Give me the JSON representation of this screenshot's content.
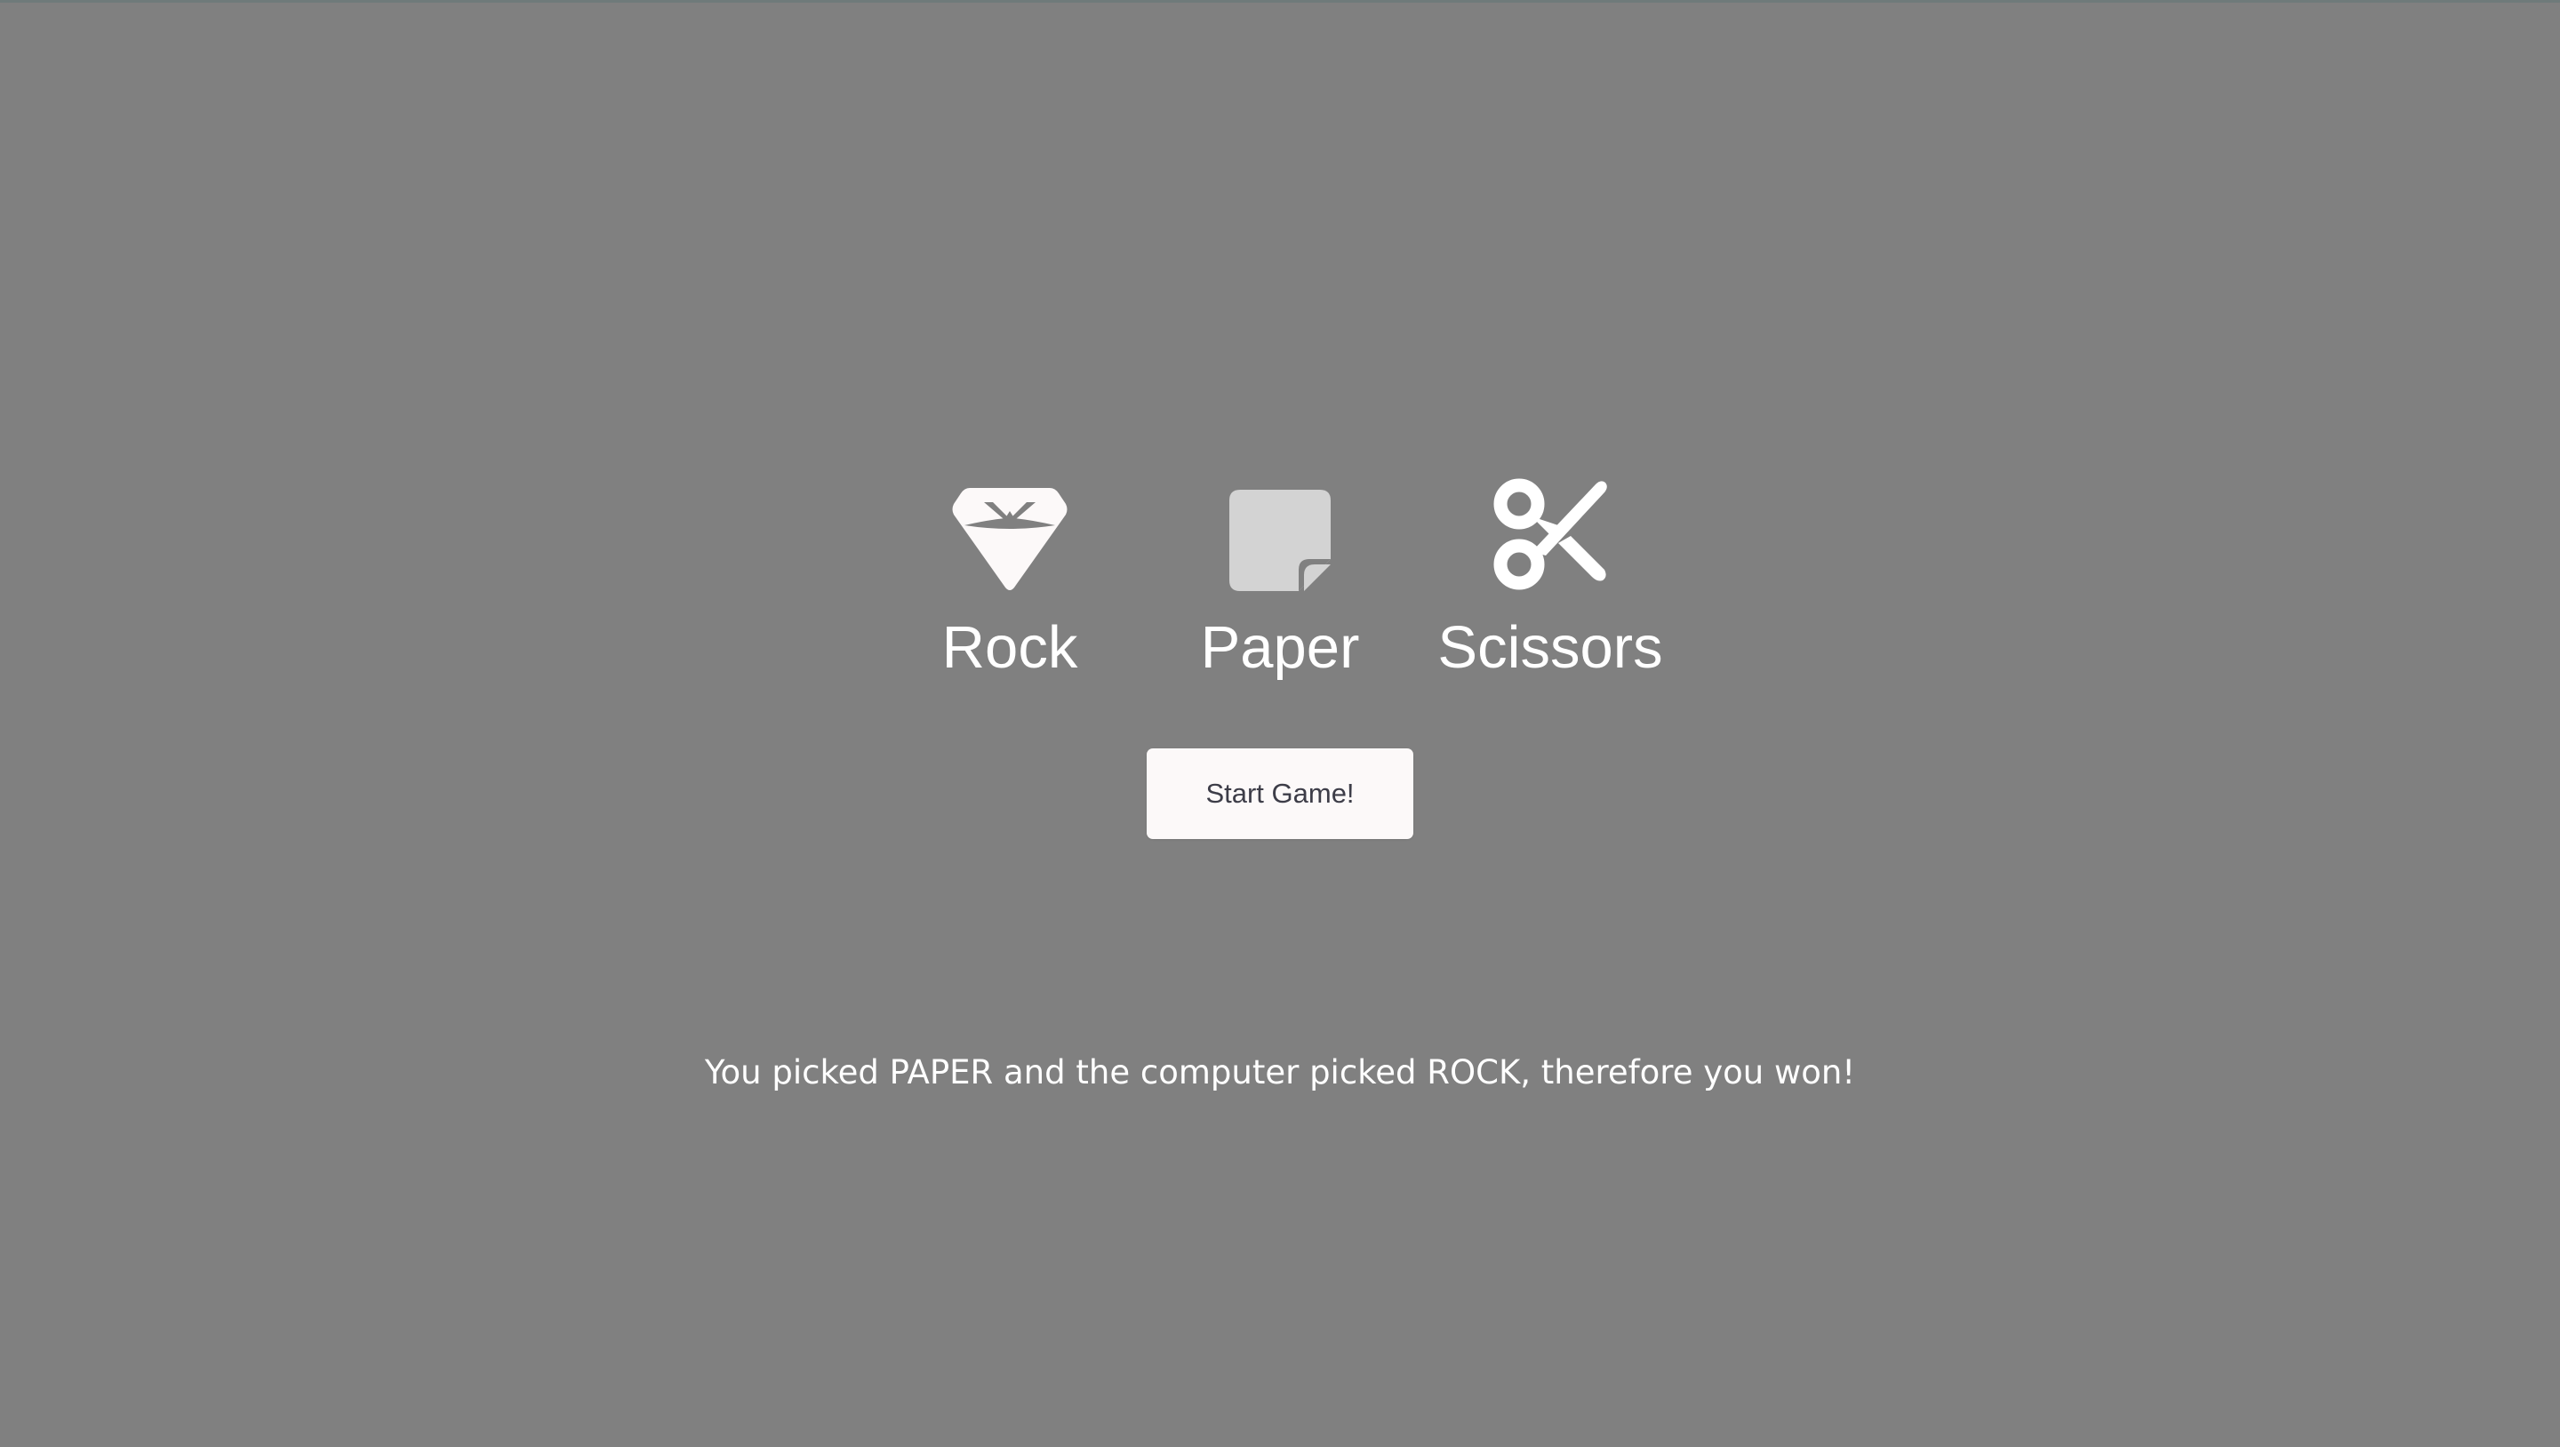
{
  "background_color": "#808080",
  "choices": [
    {
      "id": "rock",
      "label": "Rock",
      "icon": "gem-icon"
    },
    {
      "id": "paper",
      "label": "Paper",
      "icon": "sticky-note-icon"
    },
    {
      "id": "scissors",
      "label": "Scissors",
      "icon": "scissors-icon"
    }
  ],
  "start_button": {
    "label": "Start Game!"
  },
  "result": {
    "message": "You picked PAPER and the computer picked ROCK, therefore you won!"
  },
  "colors": {
    "text": "#ffffff",
    "button_bg": "#fcf9f9",
    "button_text": "#3d3d48",
    "paper_icon": "#d3d3d3"
  }
}
